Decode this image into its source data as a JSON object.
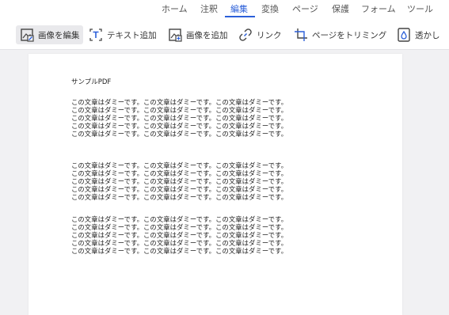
{
  "menu": {
    "items": [
      {
        "label": "ホーム"
      },
      {
        "label": "注釈"
      },
      {
        "label": "編集"
      },
      {
        "label": "変換"
      },
      {
        "label": "ページ"
      },
      {
        "label": "保護"
      },
      {
        "label": "フォーム"
      },
      {
        "label": "ツール"
      }
    ],
    "active": "編集",
    "accent_color": "#2b5fd9"
  },
  "toolbar": {
    "edit_image_label": "画像を編集",
    "add_text_label": "テキスト追加",
    "add_image_label": "画像を追加",
    "link_label": "リンク",
    "crop_page_label": "ページをトリミング",
    "watermark_label": "透かし"
  },
  "document": {
    "title": "サンプルPDF",
    "paragraphs": [
      [
        "この文章はダミーです。この文章はダミーです。この文章はダミーです。",
        "この文章はダミーです。この文章はダミーです。この文章はダミーです。",
        "この文章はダミーです。この文章はダミーです。この文章はダミーです。",
        "この文章はダミーです。この文章はダミーです。この文章はダミーです。",
        "この文章はダミーです。この文章はダミーです。この文章はダミーです。"
      ],
      [
        "この文章はダミーです。この文章はダミーです。この文章はダミーです。",
        "この文章はダミーです。この文章はダミーです。この文章はダミーです。",
        "この文章はダミーです。この文章はダミーです。この文章はダミーです。",
        "この文章はダミーです。この文章はダミーです。この文章はダミーです。",
        "この文章はダミーです。この文章はダミーです。この文章はダミーです。"
      ],
      [
        "この文章はダミーです。この文章はダミーです。この文章はダミーです。",
        "この文章はダミーです。この文章はダミーです。この文章はダミーです。",
        "この文章はダミーです。この文章はダミーです。この文章はダミーです。",
        "この文章はダミーです。この文章はダミーです。この文章はダミーです。",
        "この文章はダミーです。この文章はダミーです。この文章はダミーです。"
      ]
    ]
  }
}
